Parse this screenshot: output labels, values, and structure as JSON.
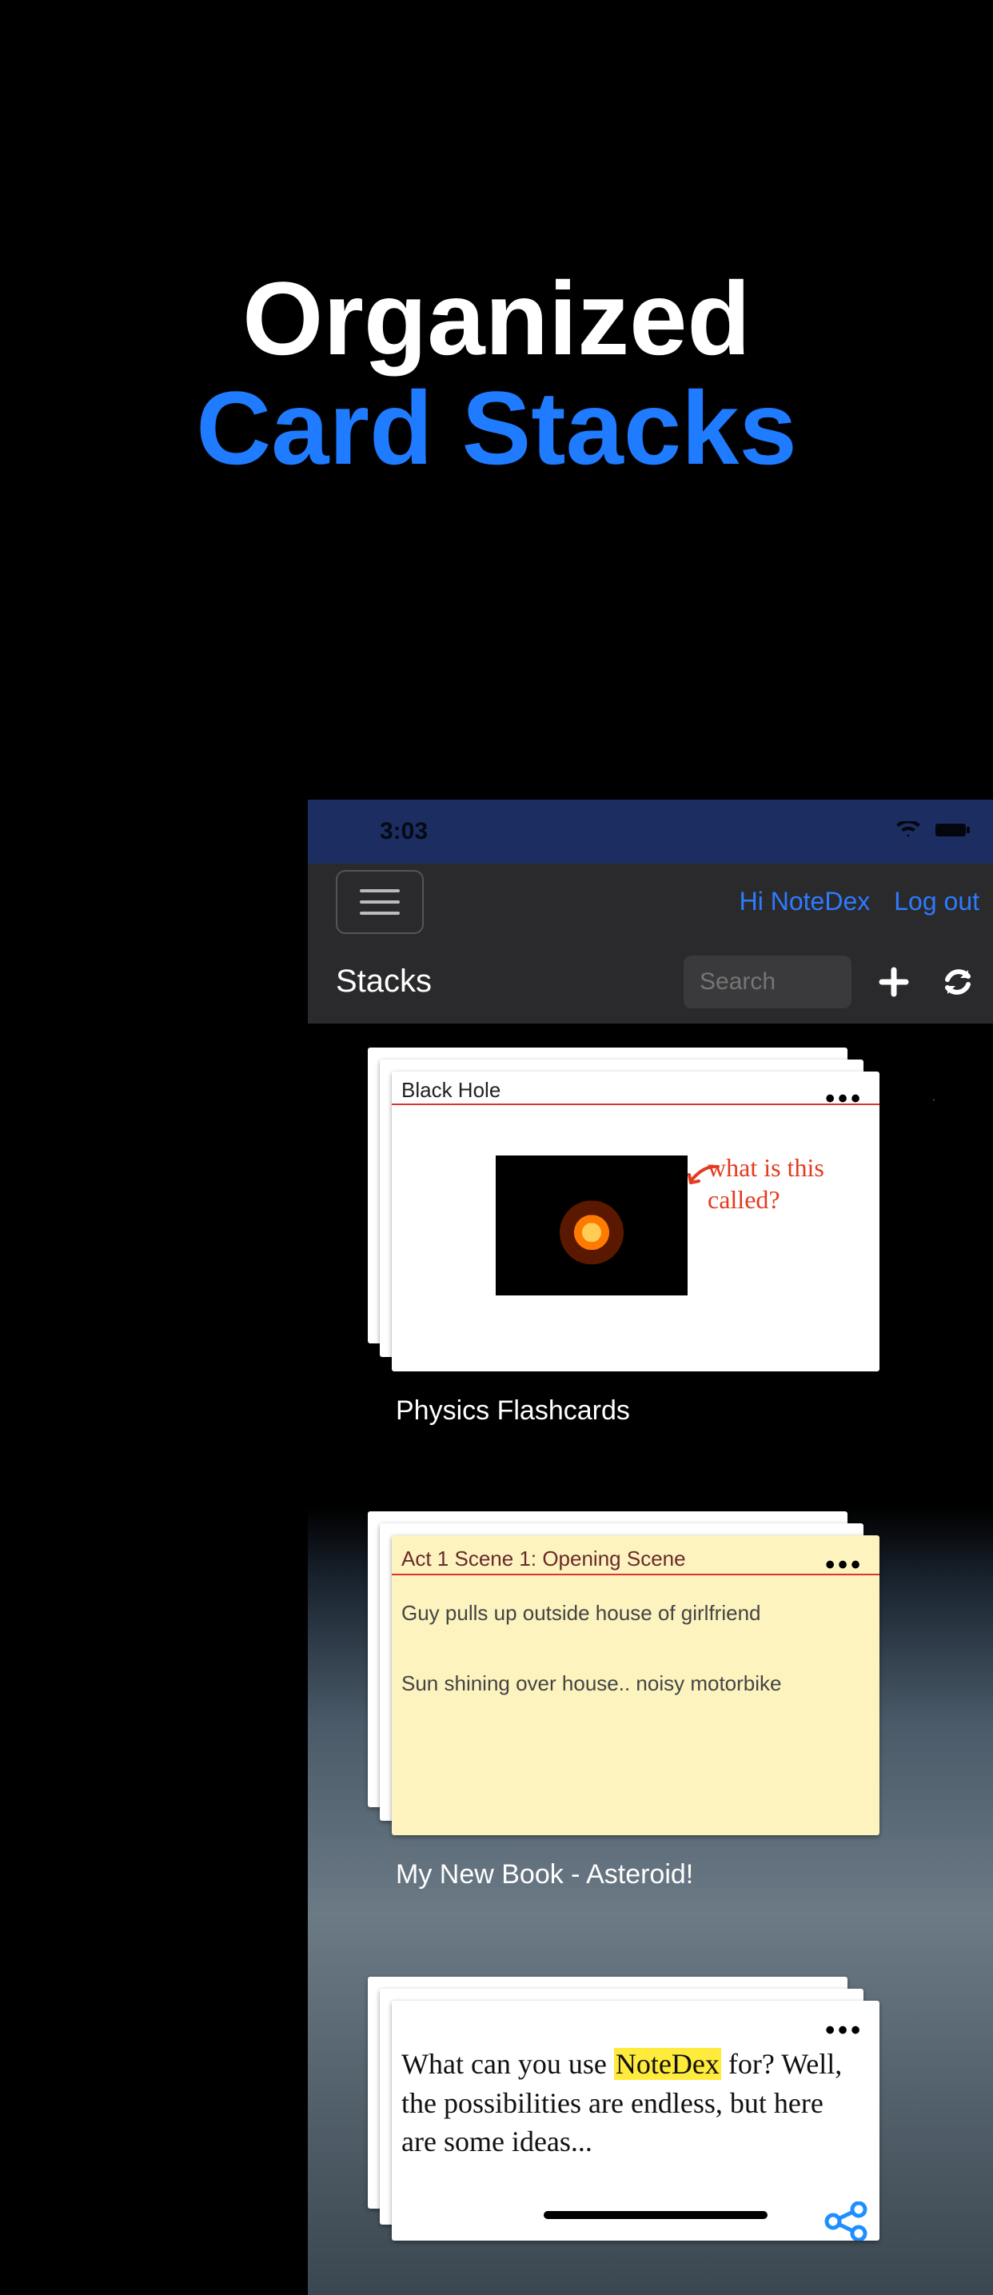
{
  "hero": {
    "line1": "Organized",
    "line2": "Card Stacks"
  },
  "statusbar": {
    "time": "3:03"
  },
  "topnav": {
    "greeting": "Hi NoteDex",
    "logout": "Log out"
  },
  "toolbar": {
    "title": "Stacks",
    "search_placeholder": "Search"
  },
  "stacks": [
    {
      "label": "Physics Flashcards",
      "card_title": "Black Hole",
      "annotation": "what is this called?"
    },
    {
      "label": "My New Book - Asteroid!",
      "card_title": "Act 1 Scene 1: Opening Scene",
      "body_line1": "Guy pulls up outside house of girlfriend",
      "body_line2": "Sun shining over house.. noisy motorbike"
    },
    {
      "text_pre": "What can you use ",
      "text_highlight": "NoteDex",
      "text_post": " for? Well, the possibilities are endless, but here are some ideas..."
    }
  ]
}
